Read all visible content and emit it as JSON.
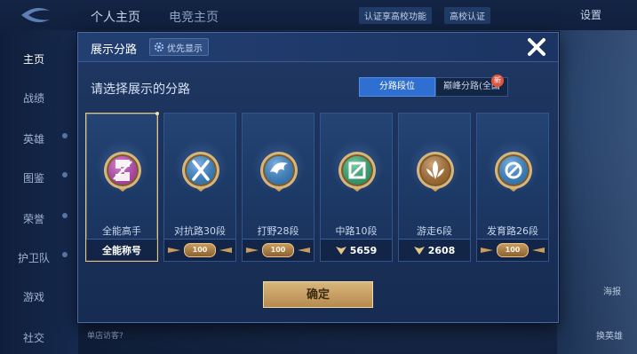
{
  "background": {
    "top_tabs": [
      "个人主页",
      "电竞主页"
    ],
    "top_chips": [
      "认证享高校功能",
      "高校认证"
    ],
    "settings_label": "设置",
    "sidebar": [
      "主页",
      "战绩",
      "英雄",
      "图鉴",
      "荣誉",
      "护卫队",
      "游戏",
      "社交"
    ],
    "right_labels": [
      "海报",
      "换英雄"
    ],
    "bottom_text": "单店访客?"
  },
  "modal": {
    "title": "展示分路",
    "priority_label": "优先显示",
    "close_glyph": "✕",
    "prompt": "请选择展示的分路",
    "tabs": [
      {
        "label": "分路段位",
        "active": true
      },
      {
        "label": "巅峰分路(全国",
        "active": false
      }
    ],
    "new_badge": "新",
    "cards": [
      {
        "label": "全能高手",
        "footer_type": "text",
        "footer_text": "全能称号",
        "selected": true,
        "icon": "all-round-emblem-icon",
        "color": "#c94fc0"
      },
      {
        "label": "对抗路30段",
        "footer_type": "badge",
        "footer_text": "100",
        "selected": false,
        "icon": "clash-lane-emblem-icon",
        "color": "#3f8fd8"
      },
      {
        "label": "打野28段",
        "footer_type": "badge",
        "footer_text": "100",
        "selected": false,
        "icon": "jungle-emblem-icon",
        "color": "#3f8fd8"
      },
      {
        "label": "中路10段",
        "footer_type": "points",
        "footer_text": "5659",
        "selected": false,
        "icon": "mid-lane-emblem-icon",
        "color": "#39b57a"
      },
      {
        "label": "游走6段",
        "footer_type": "points",
        "footer_text": "2608",
        "selected": false,
        "icon": "roam-emblem-icon",
        "color": "#b77a38"
      },
      {
        "label": "发育路26段",
        "footer_type": "badge",
        "footer_text": "100",
        "selected": false,
        "icon": "farm-lane-emblem-icon",
        "color": "#3f8fd8"
      }
    ],
    "confirm_label": "确定"
  }
}
